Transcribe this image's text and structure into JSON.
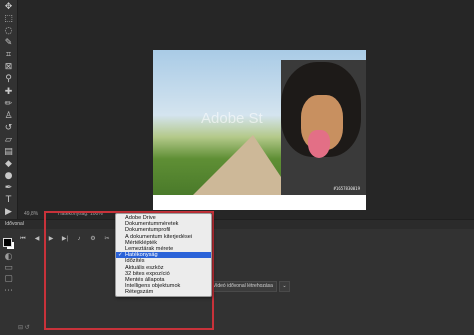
{
  "tools": [
    {
      "icon": "move-icon",
      "glyph": "✥"
    },
    {
      "icon": "marquee-icon",
      "glyph": "⬚"
    },
    {
      "icon": "lasso-icon",
      "glyph": "◌"
    },
    {
      "icon": "quick-select-icon",
      "glyph": "✎"
    },
    {
      "icon": "crop-icon",
      "glyph": "⌗"
    },
    {
      "icon": "frame-icon",
      "glyph": "⊠"
    },
    {
      "icon": "eyedropper-icon",
      "glyph": "⚲"
    },
    {
      "icon": "healing-brush-icon",
      "glyph": "✚"
    },
    {
      "icon": "brush-icon",
      "glyph": "✏"
    },
    {
      "icon": "clone-stamp-icon",
      "glyph": "♙"
    },
    {
      "icon": "history-brush-icon",
      "glyph": "↺"
    },
    {
      "icon": "eraser-icon",
      "glyph": "▱"
    },
    {
      "icon": "gradient-icon",
      "glyph": "▤"
    },
    {
      "icon": "blur-icon",
      "glyph": "◆"
    },
    {
      "icon": "dodge-icon",
      "glyph": "●"
    },
    {
      "icon": "pen-icon",
      "glyph": "✒"
    },
    {
      "icon": "type-icon",
      "glyph": "T"
    },
    {
      "icon": "path-select-icon",
      "glyph": "▶"
    },
    {
      "icon": "rectangle-icon",
      "glyph": "▭"
    },
    {
      "icon": "hand-icon",
      "glyph": "✋"
    },
    {
      "icon": "zoom-icon",
      "glyph": "⌕"
    },
    {
      "icon": "more-tools-icon",
      "glyph": "···"
    }
  ],
  "side_icons": [
    {
      "icon": "quick-mask-icon",
      "glyph": "◐"
    },
    {
      "icon": "screen-mode-icon",
      "glyph": "▭"
    },
    {
      "icon": "artboard-icon",
      "glyph": "▢"
    },
    {
      "icon": "edit-toolbar-icon",
      "glyph": "⋯"
    }
  ],
  "document": {
    "watermark": "Adobe St",
    "stock_id": "#1657830019"
  },
  "status": {
    "zoom": "49,8%",
    "info": "Hatékonyság: 100%*"
  },
  "timeline": {
    "title": "Idővonal",
    "controls": [
      {
        "icon": "first-frame-icon",
        "glyph": "⏮"
      },
      {
        "icon": "prev-frame-icon",
        "glyph": "◀"
      },
      {
        "icon": "play-icon",
        "glyph": "▶"
      },
      {
        "icon": "next-frame-icon",
        "glyph": "▶|"
      },
      {
        "icon": "audio-icon",
        "glyph": "♪"
      },
      {
        "icon": "settings-icon",
        "glyph": "⚙"
      },
      {
        "icon": "split-icon",
        "glyph": "✂"
      }
    ],
    "create_button": "Videó idővonal létrehozása",
    "create_arrow": "⌄",
    "bottom_controls": "⊟ ↺"
  },
  "menu": {
    "items": [
      {
        "label": "Adobe Drive",
        "checked": false
      },
      {
        "label": "Dokumentumméretek",
        "checked": false
      },
      {
        "label": "Dokumentumprofil",
        "checked": false
      },
      {
        "label": "A dokumentum kiterjedései",
        "checked": false
      },
      {
        "label": "Mértéklépték",
        "checked": false
      },
      {
        "label": "Lemeztárak mérete",
        "checked": false
      },
      {
        "label": "Hatékonyság",
        "checked": true
      },
      {
        "label": "Időzítés",
        "checked": false
      },
      {
        "label": "Aktuális eszköz",
        "checked": false
      },
      {
        "label": "32 bites expozíció",
        "checked": false
      },
      {
        "label": "Mentés állapota",
        "checked": false
      },
      {
        "label": "Intelligens objektumok",
        "checked": false
      },
      {
        "label": "Rétegszám",
        "checked": false
      }
    ],
    "check_glyph": "✓"
  },
  "colors": {
    "highlight": "#c8323a",
    "menu_selection": "#2a62d8"
  }
}
